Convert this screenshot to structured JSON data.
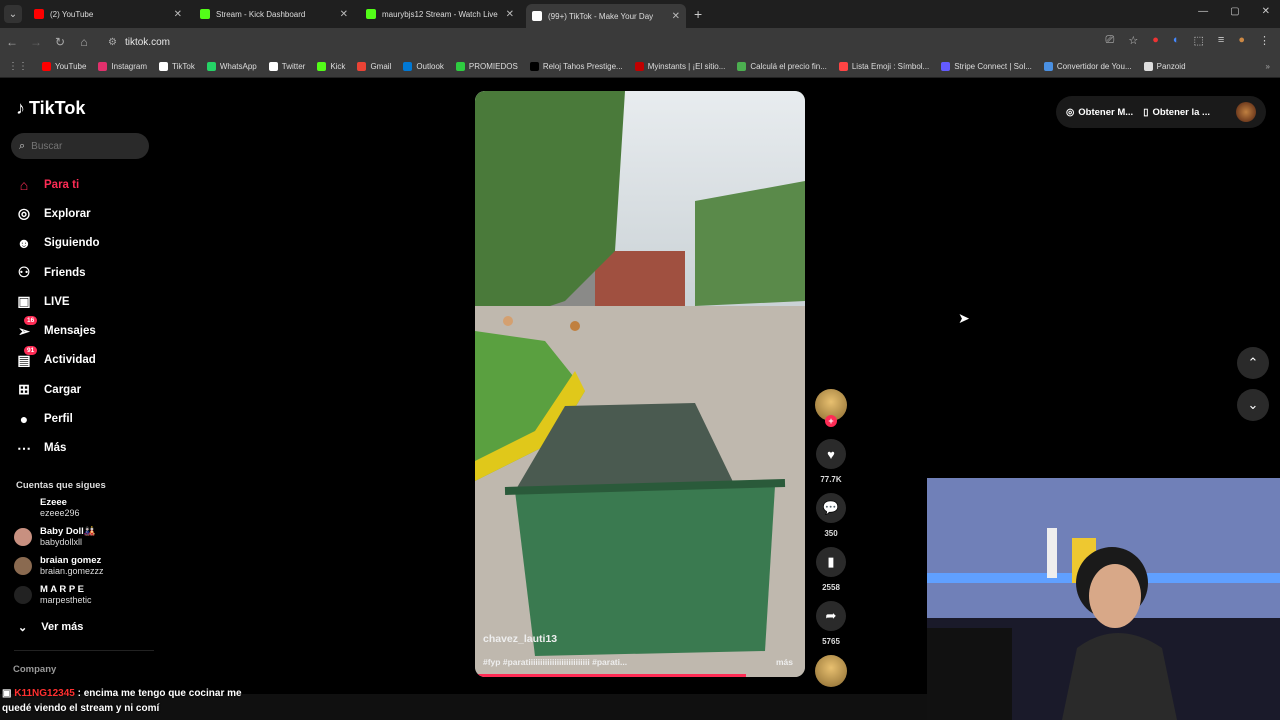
{
  "tabs": [
    {
      "title": "(2) YouTube",
      "color": "#ff0000",
      "active": false
    },
    {
      "title": "Stream - Kick Dashboard",
      "color": "#53fc18",
      "active": false
    },
    {
      "title": "maurybjs12 Stream - Watch Live",
      "color": "#53fc18",
      "active": false
    },
    {
      "title": "(99+) TikTok - Make Your Day",
      "color": "#ffffff",
      "active": true
    }
  ],
  "address": {
    "url": "tiktok.com"
  },
  "bookmarks": [
    {
      "label": "YouTube",
      "color": "#ff0000"
    },
    {
      "label": "Instagram",
      "color": "#e1306c"
    },
    {
      "label": "TikTok",
      "color": "#ffffff"
    },
    {
      "label": "WhatsApp",
      "color": "#25d366"
    },
    {
      "label": "Twitter",
      "color": "#ffffff"
    },
    {
      "label": "Kick",
      "color": "#53fc18"
    },
    {
      "label": "Gmail",
      "color": "#ea4335"
    },
    {
      "label": "Outlook",
      "color": "#0078d4"
    },
    {
      "label": "PROMIEDOS",
      "color": "#2ecc40"
    },
    {
      "label": "Reloj Tahos Prestige...",
      "color": "#000000"
    },
    {
      "label": "Myinstants | ¡El sitio...",
      "color": "#c00000"
    },
    {
      "label": "Calculá el precio fin...",
      "color": "#4caf50"
    },
    {
      "label": "Lista Emoji : Símbol...",
      "color": "#ff4444"
    },
    {
      "label": "Stripe Connect | Sol...",
      "color": "#635bff"
    },
    {
      "label": "Convertidor de You...",
      "color": "#4a90e2"
    },
    {
      "label": "Panzoid",
      "color": "#dddddd"
    }
  ],
  "sidebar": {
    "logo": "TikTok",
    "search_placeholder": "Buscar",
    "items": [
      {
        "label": "Para ti",
        "icon": "home-icon",
        "active": true
      },
      {
        "label": "Explorar",
        "icon": "compass-icon"
      },
      {
        "label": "Siguiendo",
        "icon": "following-icon"
      },
      {
        "label": "Friends",
        "icon": "friends-icon"
      },
      {
        "label": "LIVE",
        "icon": "live-icon"
      },
      {
        "label": "Mensajes",
        "icon": "messages-icon",
        "badge": "16"
      },
      {
        "label": "Actividad",
        "icon": "activity-icon",
        "badge": "91"
      },
      {
        "label": "Cargar",
        "icon": "upload-icon"
      },
      {
        "label": "Perfil",
        "icon": "profile-icon"
      },
      {
        "label": "Más",
        "icon": "more-icon"
      }
    ],
    "following_title": "Cuentas que sigues",
    "following": [
      {
        "name": "Ezeee",
        "handle": "ezeee296"
      },
      {
        "name": "Baby Doll🎎",
        "handle": "babydollxll"
      },
      {
        "name": "braian gomez",
        "handle": "braian.gomezzz"
      },
      {
        "name": "M A R P E",
        "handle": "marpesthetic"
      }
    ],
    "see_more": "Ver más",
    "company": "Company"
  },
  "video": {
    "username": "chavez_lauti13",
    "caption": "#fyp #paratiiiiiiiiiiiiiiiiiiiiiiiiii #parati...",
    "more": "más",
    "progress": 0.82
  },
  "actions": {
    "likes": "77.7K",
    "comments": "350",
    "saves": "2558",
    "shares": "5765"
  },
  "topright": {
    "coins": "Obtener M...",
    "app": "Obtener la ..."
  },
  "chat": {
    "name": "K11NG12345",
    "message": ": encima me tengo que cocinar me",
    "message2": "quedé viendo el stream y ni comí"
  }
}
